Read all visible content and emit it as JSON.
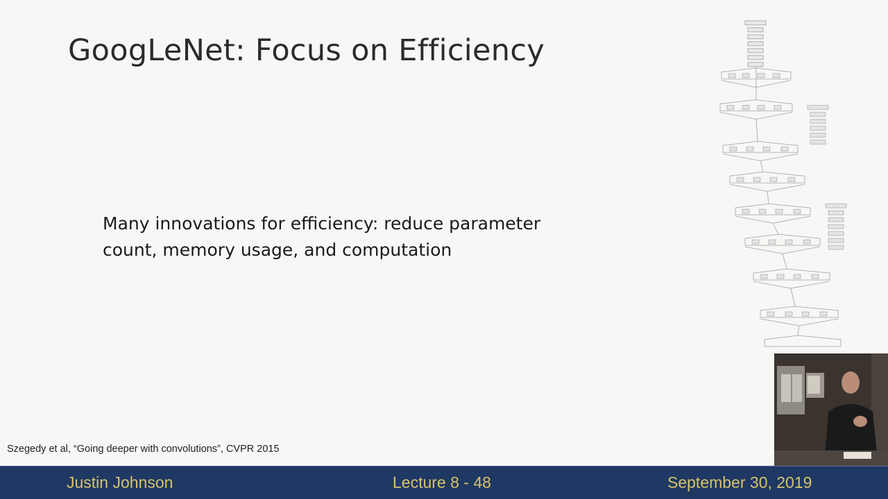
{
  "slide": {
    "title": "GoogLeNet: Focus on Efficiency",
    "body_text": "Many innovations for efficiency: reduce parameter count, memory usage, and computation",
    "citation": "Szegedy et al, “Going deeper with convolutions”, CVPR 2015"
  },
  "footer": {
    "author": "Justin Johnson",
    "lecture": "Lecture 8 - 48",
    "date": "September 30, 2019"
  },
  "diagram": {
    "icon": "googlenet-architecture-diagram"
  },
  "colors": {
    "footer_bg": "#1f3864",
    "footer_text": "#d6c36a"
  }
}
